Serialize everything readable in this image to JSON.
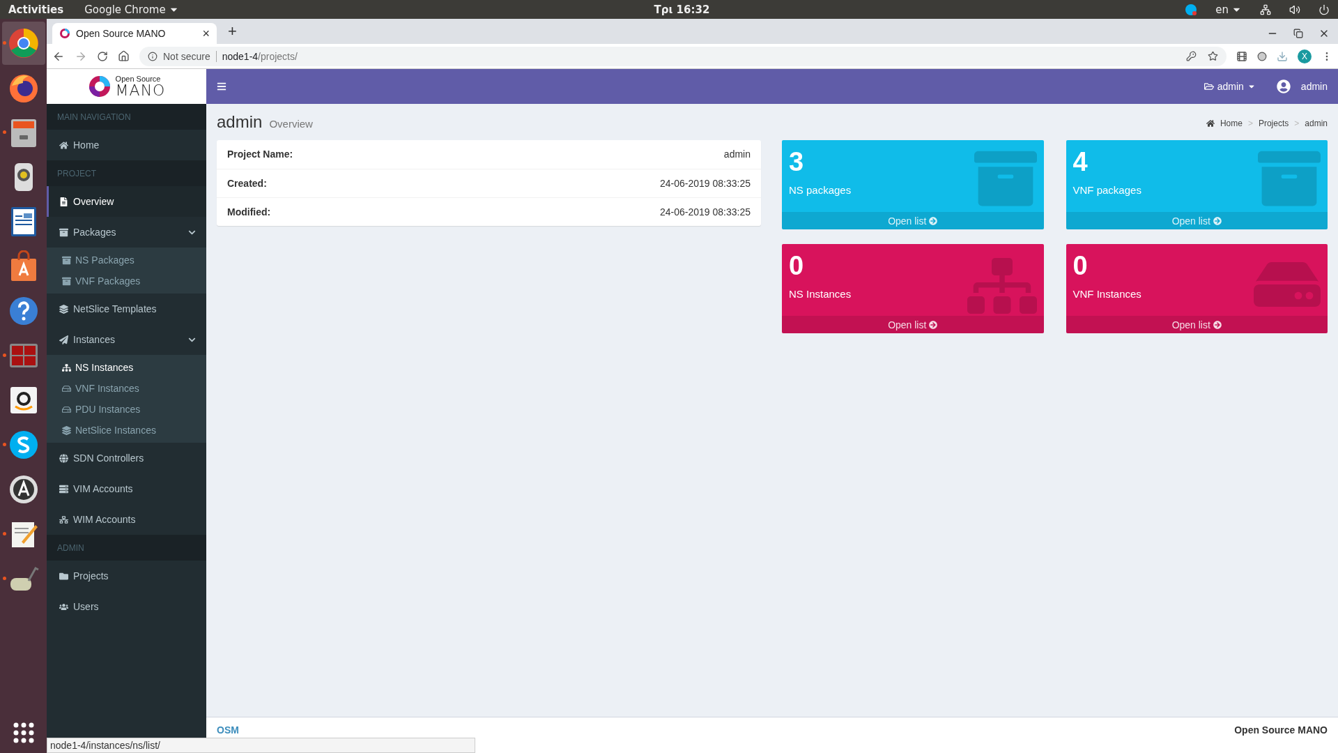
{
  "desktop_topbar": {
    "activities": "Activities",
    "app_menu": "Google Chrome",
    "clock": "Τρι 16:32",
    "language": "en"
  },
  "dock": [
    {
      "kind": "browser",
      "running": true,
      "selected": true
    },
    {
      "kind": "firefox",
      "running": false,
      "selected": false
    },
    {
      "kind": "files",
      "running": true,
      "selected": false
    },
    {
      "kind": "speaker",
      "running": false,
      "selected": false
    },
    {
      "kind": "writer",
      "running": false,
      "selected": false
    },
    {
      "kind": "store",
      "running": false,
      "selected": false
    },
    {
      "kind": "help",
      "running": false,
      "selected": false
    },
    {
      "kind": "terminal",
      "running": true,
      "selected": false
    },
    {
      "kind": "amazon",
      "running": false,
      "selected": false
    },
    {
      "kind": "skype",
      "running": true,
      "selected": false
    },
    {
      "kind": "updater",
      "running": false,
      "selected": false
    },
    {
      "kind": "editor",
      "running": true,
      "selected": false
    },
    {
      "kind": "roller",
      "running": true,
      "selected": false
    }
  ],
  "browser": {
    "tab": {
      "title": "Open Source MANO",
      "close": "×"
    },
    "new_tab": "+",
    "security": "Not secure",
    "url_host": "node1-4",
    "url_path": "/projects/",
    "profile": "X",
    "status_url": "node1-4/instances/ns/list/"
  },
  "app": {
    "logo_top": "Open Source",
    "logo_bottom": "MANO",
    "project_menu": "admin",
    "user": "admin"
  },
  "sidebar": [
    {
      "kind": "header",
      "label": "MAIN NAVIGATION"
    },
    {
      "kind": "item",
      "label": "Home",
      "selected": false
    },
    {
      "kind": "header",
      "label": "PROJECT"
    },
    {
      "kind": "item",
      "label": "Overview",
      "selected": true
    },
    {
      "kind": "item",
      "label": "Packages",
      "selected": false,
      "expanded": true,
      "children": [
        {
          "label": "NS Packages",
          "selected": false
        },
        {
          "label": "VNF Packages",
          "selected": false
        }
      ]
    },
    {
      "kind": "item",
      "label": "NetSlice Templates",
      "selected": false
    },
    {
      "kind": "item",
      "label": "Instances",
      "selected": false,
      "expanded": true,
      "children": [
        {
          "label": "NS Instances",
          "selected": true
        },
        {
          "label": "VNF Instances",
          "selected": false
        },
        {
          "label": "PDU Instances",
          "selected": false
        },
        {
          "label": "NetSlice Instances",
          "selected": false
        }
      ]
    },
    {
      "kind": "item",
      "label": "SDN Controllers",
      "selected": false
    },
    {
      "kind": "item",
      "label": "VIM Accounts",
      "selected": false
    },
    {
      "kind": "item",
      "label": "WIM Accounts",
      "selected": false
    },
    {
      "kind": "header",
      "label": "ADMIN"
    },
    {
      "kind": "item",
      "label": "Projects",
      "selected": false
    },
    {
      "kind": "item",
      "label": "Users",
      "selected": false
    }
  ],
  "page": {
    "title": "admin",
    "subtitle": "Overview"
  },
  "breadcrumb": [
    {
      "label": "Home"
    },
    {
      "separator": ">",
      "label": "Projects"
    },
    {
      "separator": ">",
      "label": "admin"
    }
  ],
  "details": [
    {
      "label": "Project Name:",
      "value": "admin"
    },
    {
      "label": "Created:",
      "value": "24-06-2019 08:33:25"
    },
    {
      "label": "Modified:",
      "value": "24-06-2019 08:33:25"
    }
  ],
  "stat_boxes": [
    {
      "count": "3",
      "label": "NS packages",
      "link": "Open list",
      "color": "#10bce9"
    },
    {
      "count": "4",
      "label": "VNF packages",
      "link": "Open list",
      "color": "#10bce9"
    },
    {
      "count": "0",
      "label": "NS Instances",
      "link": "Open list",
      "color": "#d8135c"
    },
    {
      "count": "0",
      "label": "VNF Instances",
      "link": "Open list",
      "color": "#d8135c"
    }
  ],
  "footer": {
    "left": "OSM",
    "right": "Open Source MANO"
  }
}
